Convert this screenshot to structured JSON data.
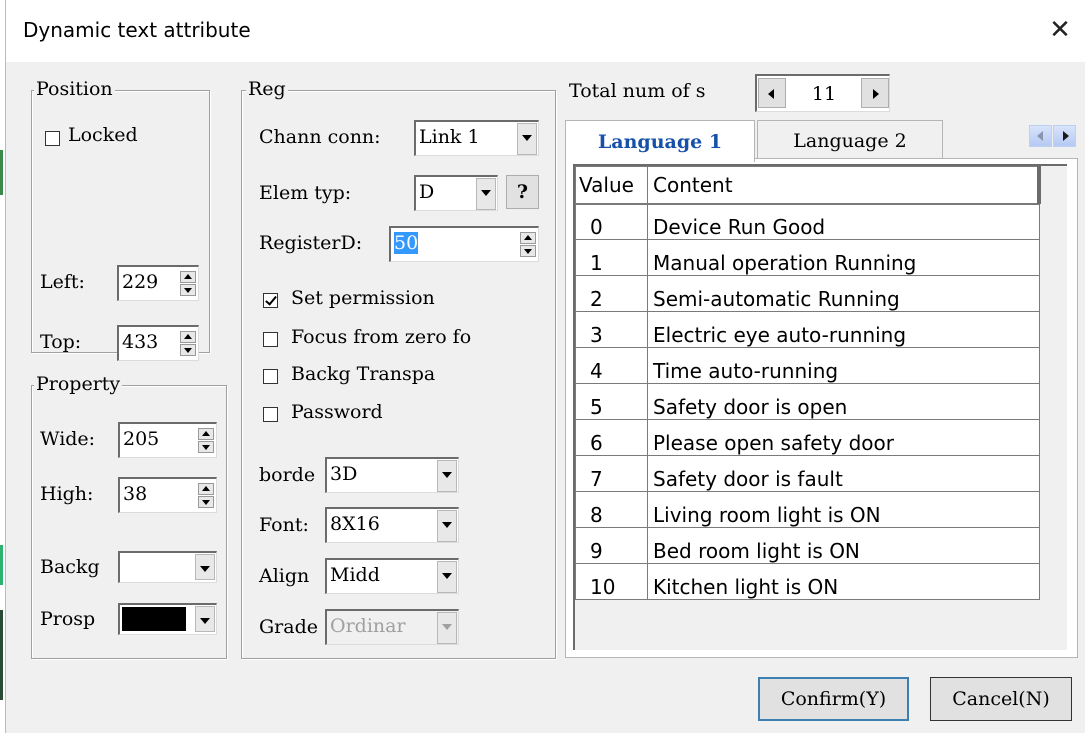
{
  "window": {
    "title": "Dynamic text attribute"
  },
  "position": {
    "title": "Position",
    "locked_label": "Locked",
    "locked": false,
    "left_label": "Left:",
    "left_value": "229",
    "top_label": "Top:",
    "top_value": "433"
  },
  "property": {
    "title": "Property",
    "wide_label": "Wide:",
    "wide_value": "205",
    "high_label": "High:",
    "high_value": "38",
    "backg_label": "Backg",
    "backg_color": "#ffffff",
    "prosp_label": "Prosp",
    "prosp_color": "#000000"
  },
  "reg": {
    "title": "Reg",
    "chann_label": "Chann conn:",
    "chann_value": "Link 1",
    "elem_label": "Elem typ:",
    "elem_value": "D",
    "help_label": "?",
    "register_label": "RegisterD:",
    "register_value": "50",
    "set_permission_label": "Set permission",
    "set_permission": true,
    "focus_label": "Focus from zero fo",
    "focus": false,
    "backg_transpa_label": "Backg Transpa",
    "backg_transpa": false,
    "password_label": "Password",
    "password": false,
    "border_label": "borde",
    "border_value": "3D",
    "font_label": "Font:",
    "font_value": "8X16",
    "align_label": "Align",
    "align_value": "Midd",
    "grade_label": "Grade",
    "grade_value": "Ordinar"
  },
  "states": {
    "total_label": "Total num of s",
    "total_value": "11",
    "tabs": [
      {
        "label": "Language 1",
        "active": true
      },
      {
        "label": "Language 2",
        "active": false
      }
    ],
    "columns": [
      "Value",
      "Content"
    ],
    "rows": [
      {
        "value": "0",
        "content": "Device Run Good"
      },
      {
        "value": "1",
        "content": "Manual operation Running"
      },
      {
        "value": "2",
        "content": "Semi-automatic Running"
      },
      {
        "value": "3",
        "content": "Electric eye auto-running"
      },
      {
        "value": "4",
        "content": "Time auto-running"
      },
      {
        "value": "5",
        "content": "Safety door is open"
      },
      {
        "value": "6",
        "content": "Please open safety door"
      },
      {
        "value": "7",
        "content": "Safety door is fault"
      },
      {
        "value": "8",
        "content": "Living room light is ON"
      },
      {
        "value": "9",
        "content": "Bed room light is ON"
      },
      {
        "value": "10",
        "content": "Kitchen light is ON"
      }
    ]
  },
  "buttons": {
    "confirm": "Confirm(Y)",
    "cancel": "Cancel(N)"
  },
  "colors": {
    "active_tab": "#1650a8",
    "selection": "#3399ff",
    "default_button_border": "#3c7fb1"
  }
}
